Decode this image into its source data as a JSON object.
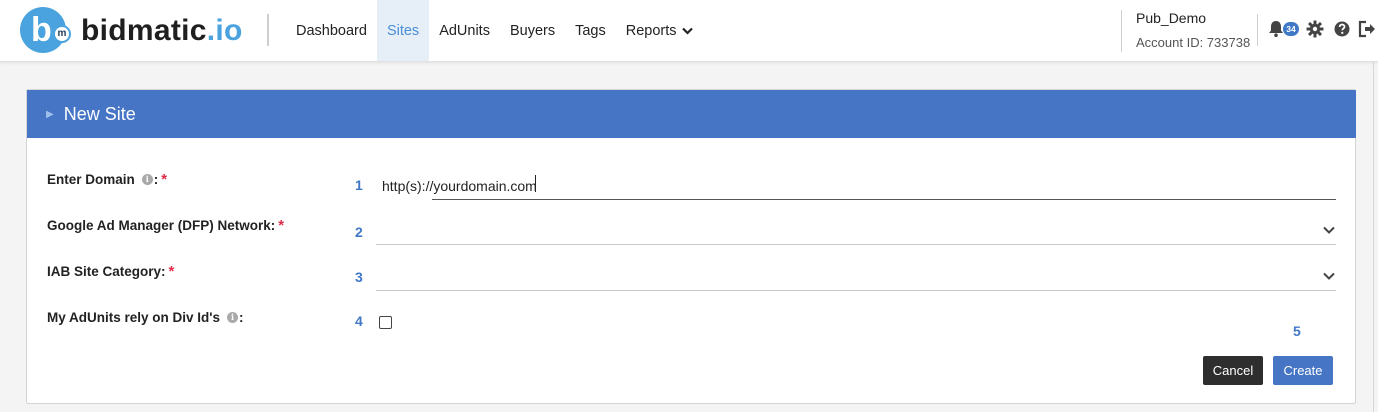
{
  "brand": {
    "logo_letter": "b",
    "logo_sub": "m",
    "name_main": "bidmatic",
    "name_accent": ".io"
  },
  "nav": {
    "items": [
      {
        "label": "Dashboard"
      },
      {
        "label": "Sites"
      },
      {
        "label": "AdUnits"
      },
      {
        "label": "Buyers"
      },
      {
        "label": "Tags"
      },
      {
        "label": "Reports"
      }
    ],
    "active": "Sites"
  },
  "account": {
    "name": "Pub_Demo",
    "id_text": "Account ID: 733738"
  },
  "notifications": {
    "count": "34"
  },
  "icons": [
    "bell-icon",
    "gear-icon",
    "help-icon",
    "logout-icon",
    "info-icon",
    "chevron-down-icon"
  ],
  "colors": {
    "accent": "#4575c4",
    "logo": "#4aa3df",
    "required": "#e02b4a",
    "cancel": "#2e2e2e",
    "step": "#3f78c6"
  },
  "form": {
    "header": "New Site",
    "domain": {
      "label": "Enter Domain",
      "colon": ":",
      "value": "http(s)://yourdomain.com",
      "step": "1"
    },
    "dfp": {
      "label": "Google Ad Manager (DFP) Network:",
      "value": "",
      "step": "2"
    },
    "iab": {
      "label": "IAB Site Category:",
      "value": "",
      "step": "3"
    },
    "divids": {
      "label": "My AdUnits rely on Div Id's",
      "colon": ":",
      "checked": false,
      "step": "4"
    },
    "actions_step": "5",
    "required_mark": "*",
    "cancel_label": "Cancel",
    "create_label": "Create"
  }
}
